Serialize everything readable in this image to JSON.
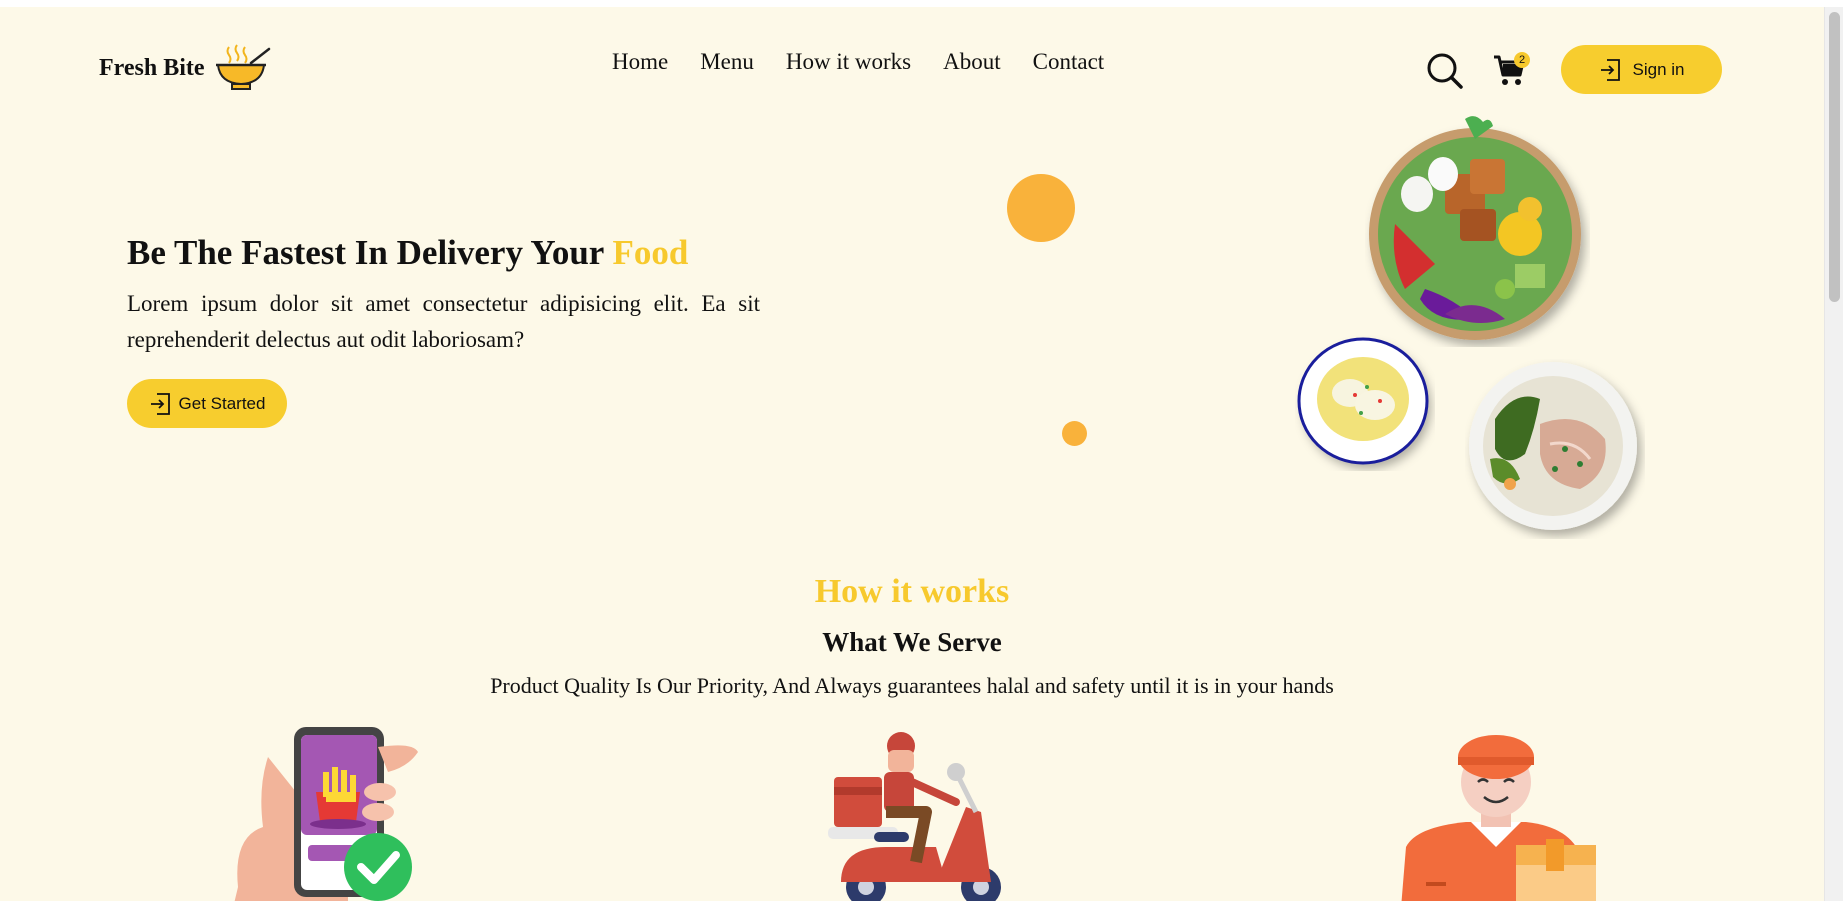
{
  "brand": {
    "name": "Fresh Bite",
    "logo_icon": "soup-bowl-icon"
  },
  "nav": {
    "items": [
      {
        "label": "Home"
      },
      {
        "label": "Menu"
      },
      {
        "label": "How it works"
      },
      {
        "label": "About"
      },
      {
        "label": "Contact"
      }
    ]
  },
  "header": {
    "search_icon": "search-icon",
    "cart_icon": "cart-icon",
    "cart_count": "2",
    "signin_label": "Sign in",
    "signin_icon": "login-icon"
  },
  "hero": {
    "title_main": "Be The Fastest In Delivery Your ",
    "title_accent": "Food",
    "text": "Lorem ipsum dolor sit amet consectetur adipisicing elit. Ea sit reprehenderit delectus aut odit laboriosam?",
    "cta_label": "Get Started",
    "cta_icon": "login-icon",
    "images": [
      "salad-bowl",
      "soup-bowl",
      "fish-plate"
    ]
  },
  "how_it_works": {
    "kicker": "How it works",
    "title": "What We Serve",
    "subtitle": "Product Quality Is Our Priority, And Always guarantees halal and safety until it is in your hands",
    "illustrations": [
      "phone-order",
      "scooter-delivery",
      "courier-with-box"
    ]
  },
  "colors": {
    "background": "#fdf9e8",
    "accent": "#f7c92d",
    "decor_orange": "#f9b23b",
    "text": "#111111"
  }
}
